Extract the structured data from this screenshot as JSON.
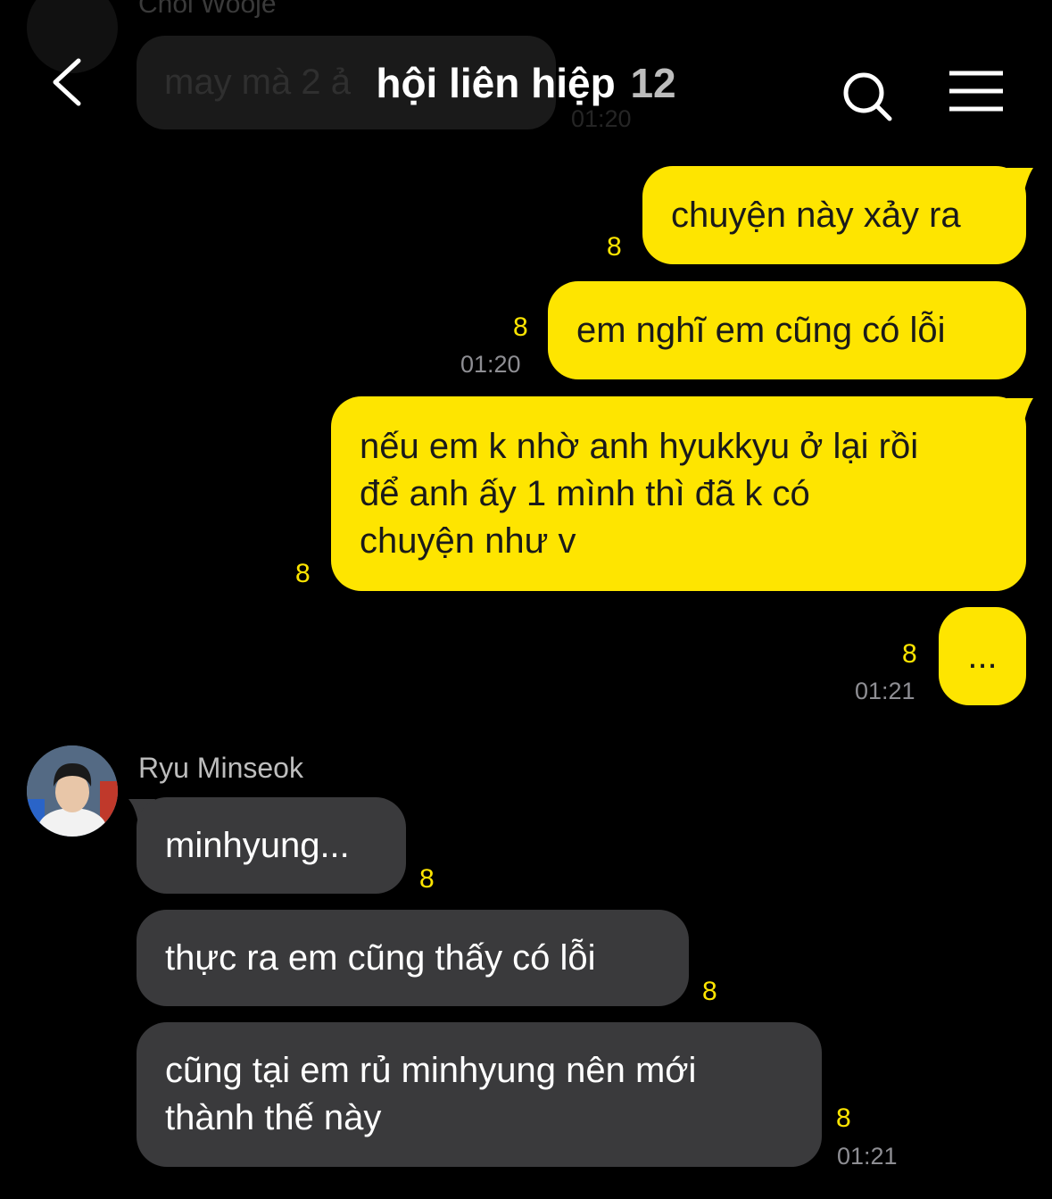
{
  "background_message": {
    "sender": "Choi Wooje",
    "text": "may mà 2 ả",
    "time": "01:20"
  },
  "header": {
    "title": "hội liên hiệp",
    "member_count": "12",
    "back_icon": "chevron-left-icon",
    "search_icon": "search-icon",
    "menu_icon": "hamburger-menu-icon"
  },
  "colors": {
    "my_bubble": "#fee500",
    "their_bubble": "#3a3a3c",
    "unread": "#fee500",
    "background": "#000000"
  },
  "messages": [
    {
      "from": "me",
      "lines": [
        "chuyện này xảy ra"
      ],
      "unread": "8",
      "time": ""
    },
    {
      "from": "me",
      "lines": [
        "em nghĩ em cũng có lỗi"
      ],
      "unread": "8",
      "time": "01:20"
    },
    {
      "from": "me",
      "lines": [
        "nếu em k nhờ anh hyukkyu ở lại rồi",
        "để anh ấy 1 mình thì đã k có",
        "chuyện như v"
      ],
      "unread": "8",
      "time": ""
    },
    {
      "from": "me",
      "lines": [
        "..."
      ],
      "unread": "8",
      "time": "01:21"
    },
    {
      "from": "Ryu Minseok",
      "lines": [
        "minhyung..."
      ],
      "unread": "8",
      "time": ""
    },
    {
      "from": "Ryu Minseok",
      "lines": [
        "thực ra em cũng thấy có lỗi"
      ],
      "unread": "8",
      "time": ""
    },
    {
      "from": "Ryu Minseok",
      "lines": [
        "cũng tại em rủ minhyung nên mới",
        "thành thế này"
      ],
      "unread": "8",
      "time": "01:21"
    }
  ],
  "sender_block": {
    "name": "Ryu Minseok"
  }
}
